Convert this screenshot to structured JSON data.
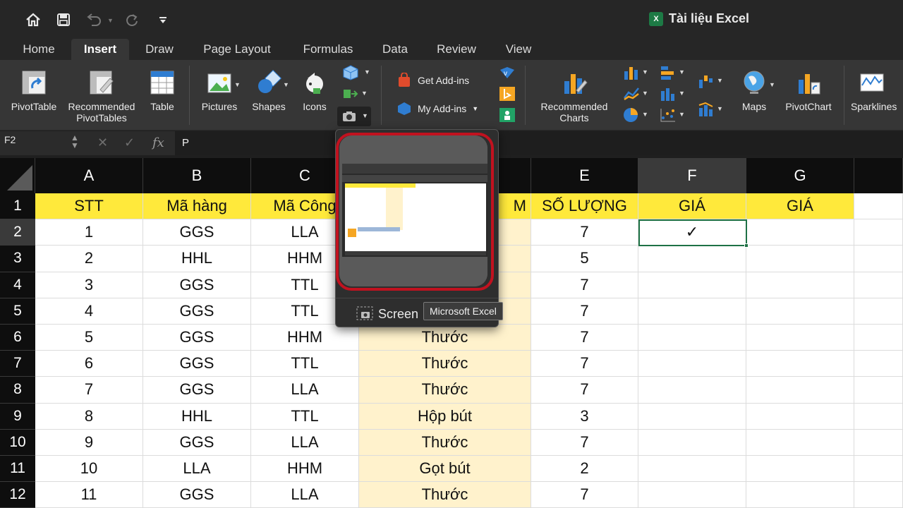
{
  "titlebar": {
    "quick_access": [
      "home-icon",
      "save-icon",
      "undo-icon",
      "redo-icon",
      "customize-icon"
    ],
    "document_title": "Tài liệu Excel",
    "app_badge": "X"
  },
  "tabs": [
    {
      "label": "Home"
    },
    {
      "label": "Insert"
    },
    {
      "label": "Draw"
    },
    {
      "label": "Page Layout"
    },
    {
      "label": "Formulas"
    },
    {
      "label": "Data"
    },
    {
      "label": "Review"
    },
    {
      "label": "View"
    }
  ],
  "active_tab": "Insert",
  "ribbon": {
    "pivottable": "PivotTable",
    "recommended_pivottables_1": "Recommended",
    "recommended_pivottables_2": "PivotTables",
    "table": "Table",
    "pictures": "Pictures",
    "shapes": "Shapes",
    "icons": "Icons",
    "get_addins": "Get Add-ins",
    "my_addins": "My Add-ins",
    "recommended_charts_1": "Recommended",
    "recommended_charts_2": "Charts",
    "maps": "Maps",
    "pivotchart": "PivotChart",
    "sparklines": "Sparklines"
  },
  "formula_bar": {
    "name_box": "F2",
    "fx": "fx",
    "value": "P"
  },
  "sheet": {
    "columns": [
      "A",
      "B",
      "C",
      "D",
      "E",
      "F",
      "G"
    ],
    "selected_column": "F",
    "selected_row": 2,
    "row_numbers": [
      1,
      2,
      3,
      4,
      5,
      6,
      7,
      8,
      9,
      10,
      11,
      12
    ],
    "header_row": [
      "STT",
      "Mã hàng",
      "Mã Công",
      "",
      "SỐ LƯỢNG",
      "GIÁ",
      "GIÁ"
    ],
    "d_header_tail": "M",
    "rows": [
      [
        "1",
        "GGS",
        "LLA",
        "",
        "7"
      ],
      [
        "2",
        "HHL",
        "HHM",
        "",
        "5"
      ],
      [
        "3",
        "GGS",
        "TTL",
        "",
        "7"
      ],
      [
        "4",
        "GGS",
        "TTL",
        "",
        "7"
      ],
      [
        "5",
        "GGS",
        "HHM",
        "Thước",
        "7"
      ],
      [
        "6",
        "GGS",
        "TTL",
        "Thước",
        "7"
      ],
      [
        "7",
        "GGS",
        "LLA",
        "Thước",
        "7"
      ],
      [
        "8",
        "HHL",
        "TTL",
        "Hộp bút",
        "3"
      ],
      [
        "9",
        "GGS",
        "LLA",
        "Thước",
        "7"
      ],
      [
        "10",
        "LLA",
        "HHM",
        "Gọt bút",
        "2"
      ],
      [
        "11",
        "GGS",
        "LLA",
        "Thước",
        "7"
      ]
    ],
    "f2_mark": "✓"
  },
  "screenshot_popover": {
    "footer_label": "Screen",
    "tooltip": "Microsoft Excel"
  },
  "colors": {
    "header_yellow": "#ffe93b",
    "tan_column": "#fff2cc",
    "highlight_red": "#c1121f",
    "selection_green": "#1e7145"
  }
}
